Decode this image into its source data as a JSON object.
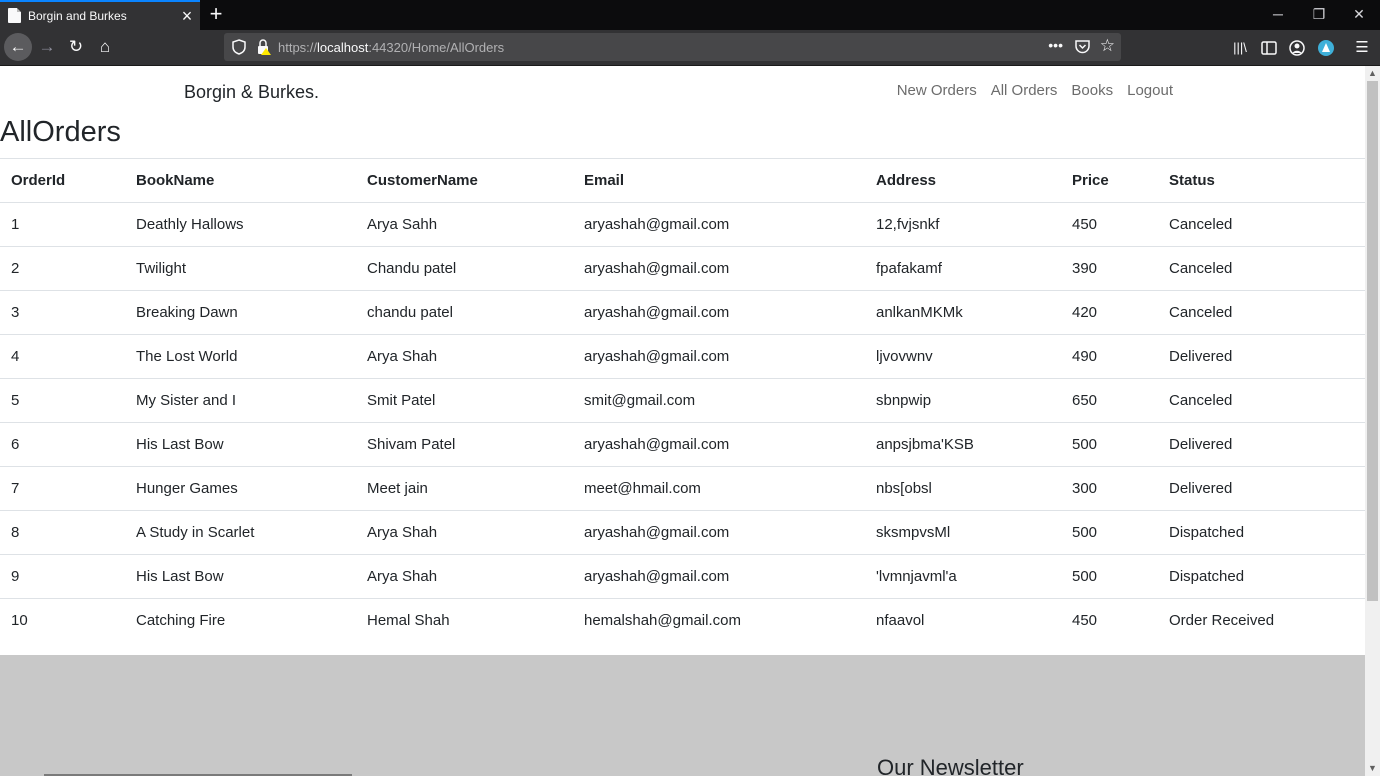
{
  "browser": {
    "tab_title": "Borgin and Burkes",
    "url_scheme": "https://",
    "url_host": "localhost",
    "url_rest": ":44320/Home/AllOrders"
  },
  "site": {
    "brand": "Borgin & Burkes.",
    "nav": [
      "New Orders",
      "All Orders",
      "Books",
      "Logout"
    ]
  },
  "page": {
    "title": "AllOrders"
  },
  "table": {
    "columns": [
      "OrderId",
      "BookName",
      "CustomerName",
      "Email",
      "Address",
      "Price",
      "Status"
    ],
    "rows": [
      [
        "1",
        "Deathly Hallows",
        "Arya Sahh",
        "aryashah@gmail.com",
        "12,fvjsnkf",
        "450",
        "Canceled"
      ],
      [
        "2",
        "Twilight",
        "Chandu patel",
        "aryashah@gmail.com",
        "fpafakamf",
        "390",
        "Canceled"
      ],
      [
        "3",
        "Breaking Dawn",
        "chandu patel",
        "aryashah@gmail.com",
        "anlkanMKMk",
        "420",
        "Canceled"
      ],
      [
        "4",
        "The Lost World",
        "Arya Shah",
        "aryashah@gmail.com",
        "ljvovwnv",
        "490",
        "Delivered"
      ],
      [
        "5",
        "My Sister and I",
        "Smit Patel",
        "smit@gmail.com",
        "sbnpwip",
        "650",
        "Canceled"
      ],
      [
        "6",
        "His Last Bow",
        "Shivam Patel",
        "aryashah@gmail.com",
        "anpsjbma'KSB",
        "500",
        "Delivered"
      ],
      [
        "7",
        "Hunger Games",
        "Meet jain",
        "meet@hmail.com",
        "nbs[obsl",
        "300",
        "Delivered"
      ],
      [
        "8",
        "A Study in Scarlet",
        "Arya Shah",
        "aryashah@gmail.com",
        "sksmpvsMl",
        "500",
        "Dispatched"
      ],
      [
        "9",
        "His Last Bow",
        "Arya Shah",
        "aryashah@gmail.com",
        "'lvmnjavml'a",
        "500",
        "Dispatched"
      ],
      [
        "10",
        "Catching Fire",
        "Hemal Shah",
        "hemalshah@gmail.com",
        "nfaavol",
        "450",
        "Order Received"
      ]
    ]
  },
  "footer": {
    "newsletter_heading": "Our Newsletter"
  }
}
